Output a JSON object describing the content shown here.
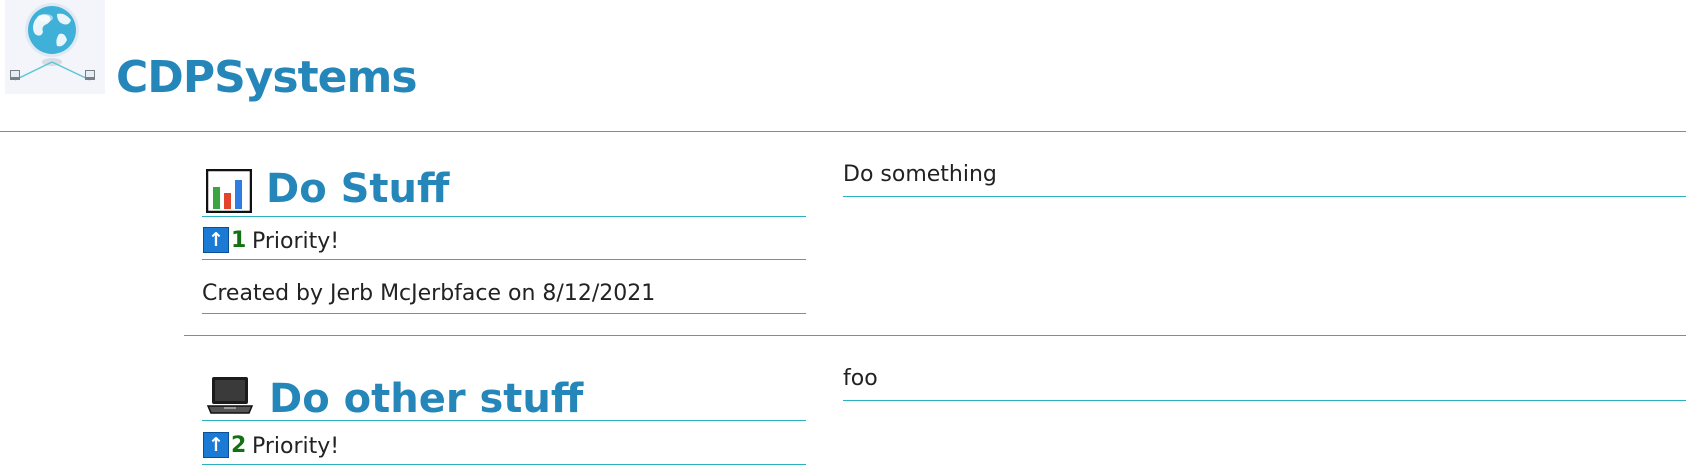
{
  "header": {
    "app_title": "CDPSystems",
    "logo_icon": "globe-network-icon"
  },
  "tasks": [
    {
      "icon": "bar-chart-icon",
      "title": "Do Stuff",
      "priority_icon": "up-arrow-icon",
      "priority_value": "1",
      "priority_label": "Priority!",
      "created": "Created by Jerb McJerbface on 8/12/2021",
      "description": "Do something"
    },
    {
      "icon": "laptop-icon",
      "title": "Do other stuff",
      "priority_icon": "up-arrow-icon",
      "priority_value": "2",
      "priority_label": "Priority!",
      "description": "foo"
    }
  ],
  "colors": {
    "accent": "#2586b9",
    "divider": "#2ab0c0",
    "priority_number": "#137113",
    "priority_icon_bg": "#1a7ad4"
  }
}
